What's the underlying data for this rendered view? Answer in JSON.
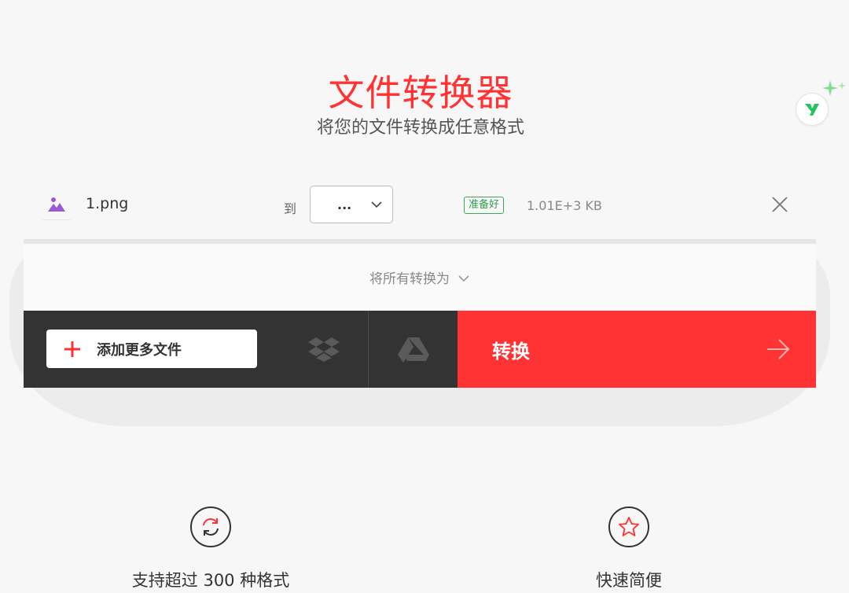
{
  "header": {
    "title": "文件转换器",
    "subtitle": "将您的文件转换成任意格式"
  },
  "file": {
    "name": "1.png",
    "to_label": "到",
    "format_value": "...",
    "status": "准备好",
    "size": "1.01E+3 KB"
  },
  "convert_all": {
    "label": "将所有转换为"
  },
  "actions": {
    "add_files": "添加更多文件",
    "convert": "转换"
  },
  "features": [
    {
      "label": "支持超过 300 种格式",
      "icon": "refresh-icon"
    },
    {
      "label": "快速简便",
      "icon": "star-icon"
    }
  ],
  "colors": {
    "accent": "#ff3333",
    "dark_bar": "#333333",
    "ready_green": "#2e9e4f",
    "file_icon": "#9b59d6"
  }
}
